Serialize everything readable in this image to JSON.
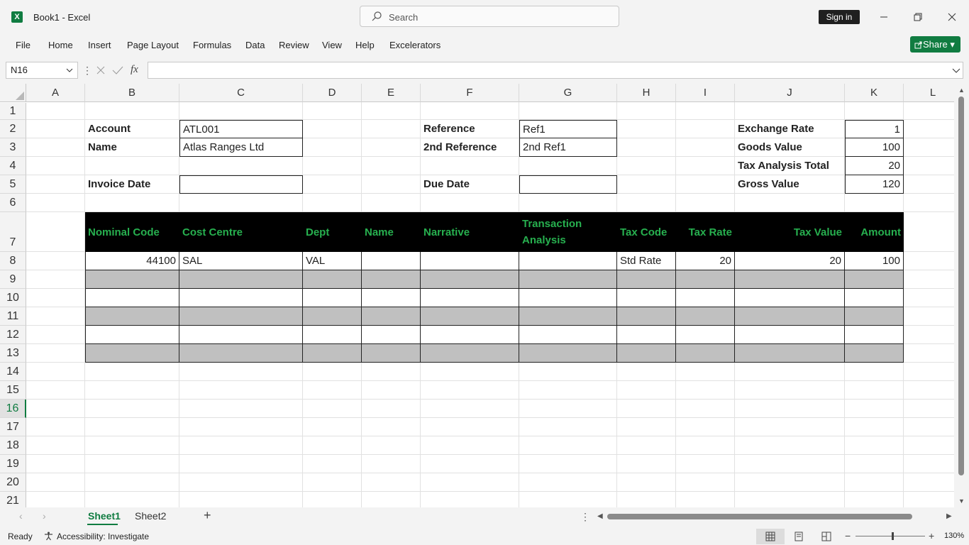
{
  "window": {
    "title": "Book1  -  Excel",
    "search_placeholder": "Search",
    "signin_label": "Sign in",
    "app_icon_letter": "X"
  },
  "menu": [
    "File",
    "Home",
    "Insert",
    "Page Layout",
    "Formulas",
    "Data",
    "Review",
    "View",
    "Help",
    "Excelerators"
  ],
  "share_label": "Share",
  "formula_bar": {
    "name_box": "N16",
    "fx": "fx",
    "formula": ""
  },
  "columns": [
    "A",
    "B",
    "C",
    "D",
    "E",
    "F",
    "G",
    "H",
    "I",
    "J",
    "K",
    "L"
  ],
  "rows": [
    "1",
    "2",
    "3",
    "4",
    "5",
    "6",
    "7",
    "8",
    "9",
    "10",
    "11",
    "12",
    "13",
    "14",
    "15",
    "16",
    "17",
    "18",
    "19",
    "20",
    "21"
  ],
  "active_row": "16",
  "header_fields": {
    "account_label": "Account",
    "account_value": "ATL001",
    "name_label": "Name",
    "name_value": "Atlas Ranges Ltd",
    "invoice_date_label": "Invoice Date",
    "invoice_date_value": "",
    "reference_label": "Reference",
    "reference_value": "Ref1",
    "second_reference_label": "2nd Reference",
    "second_reference_value": "2nd Ref1",
    "due_date_label": "Due Date",
    "due_date_value": "",
    "exchange_rate_label": "Exchange Rate",
    "exchange_rate_value": "1",
    "goods_value_label": "Goods Value",
    "goods_value_value": "100",
    "tax_analysis_total_label": "Tax Analysis Total",
    "tax_analysis_total_value": "20",
    "gross_value_label": "Gross Value",
    "gross_value_value": "120"
  },
  "table": {
    "headers": [
      "Nominal Code",
      "Cost Centre",
      "Dept",
      "Name",
      "Narrative",
      "Transaction Analysis",
      "Tax Code",
      "Tax Rate",
      "Tax Value",
      "Amount"
    ],
    "rows": [
      [
        "44100",
        "SAL",
        "VAL",
        "",
        "",
        "",
        "Std Rate",
        "20",
        "20",
        "100"
      ],
      [
        "",
        "",
        "",
        "",
        "",
        "",
        "",
        "",
        "",
        ""
      ],
      [
        "",
        "",
        "",
        "",
        "",
        "",
        "",
        "",
        "",
        ""
      ],
      [
        "",
        "",
        "",
        "",
        "",
        "",
        "",
        "",
        "",
        ""
      ],
      [
        "",
        "",
        "",
        "",
        "",
        "",
        "",
        "",
        "",
        ""
      ],
      [
        "",
        "",
        "",
        "",
        "",
        "",
        "",
        "",
        "",
        ""
      ]
    ]
  },
  "sheets": [
    "Sheet1",
    "Sheet2"
  ],
  "active_sheet": "Sheet1",
  "status": {
    "ready": "Ready",
    "accessibility": "Accessibility: Investigate",
    "zoom": "130%"
  }
}
